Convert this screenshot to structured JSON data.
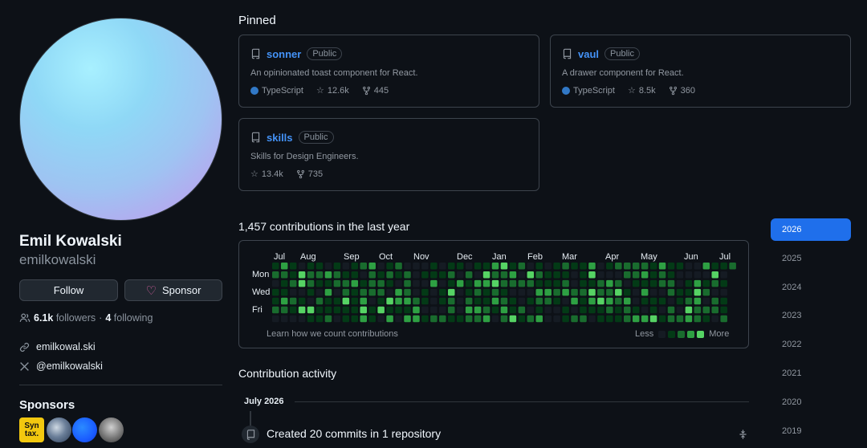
{
  "profile": {
    "name": "Emil Kowalski",
    "login": "emilkowalski",
    "follow_label": "Follow",
    "sponsor_label": "Sponsor",
    "followers_count": "6.1k",
    "followers_label": "followers",
    "separator": "·",
    "following_count": "4",
    "following_label": "following",
    "website": "emilkowal.ski",
    "twitter": "@emilkowalski",
    "sponsors_heading": "Sponsors",
    "sponsor_badge_line1": "Syn",
    "sponsor_badge_line2": "tax."
  },
  "pinned": {
    "heading": "Pinned",
    "repos": [
      {
        "name": "sonner",
        "visibility": "Public",
        "description": "An opinionated toast component for React.",
        "language": "TypeScript",
        "stars": "12.6k",
        "forks": "445"
      },
      {
        "name": "vaul",
        "visibility": "Public",
        "description": "A drawer component for React.",
        "language": "TypeScript",
        "stars": "8.5k",
        "forks": "360"
      },
      {
        "name": "skills",
        "visibility": "Public",
        "description": "Skills for Design Engineers.",
        "stars": "13.4k",
        "forks": "735"
      }
    ]
  },
  "contributions": {
    "heading": "1,457 contributions in the last year",
    "months": [
      "Jul",
      "Aug",
      "Sep",
      "Oct",
      "Nov",
      "Dec",
      "Jan",
      "Feb",
      "Mar",
      "Apr",
      "May",
      "Jun",
      "Jul"
    ],
    "day_labels": [
      "Mon",
      "Wed",
      "Fri"
    ],
    "learn_link": "Learn how we count contributions",
    "legend_less": "Less",
    "legend_more": "More",
    "level_colors": [
      "#151b23",
      "#033a16",
      "#196c2e",
      "#2ea043",
      "#56d364"
    ],
    "weeks": 53,
    "days": 7
  },
  "years": {
    "items": [
      "2026",
      "2025",
      "2024",
      "2023",
      "2022",
      "2021",
      "2020",
      "2019"
    ],
    "active": "2026"
  },
  "activity": {
    "heading": "Contribution activity",
    "month": "July 2026",
    "event": "Created 20 commits in 1 repository"
  },
  "colors": {
    "accent": "#4493f8",
    "active_year": "#1f6feb",
    "typescript": "#3178c6",
    "heart": "#db61a2"
  }
}
